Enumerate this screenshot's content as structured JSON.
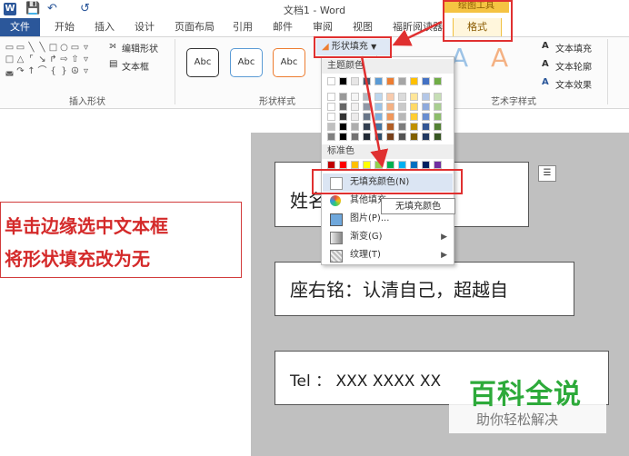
{
  "window": {
    "title": "文档1 - Word"
  },
  "quick_access": {
    "save_icon": "save-icon",
    "undo_icon": "undo-icon",
    "redo_icon": "redo-icon"
  },
  "context_tab": {
    "group": "绘图工具",
    "tab": "格式"
  },
  "tabs": [
    "文件",
    "开始",
    "插入",
    "设计",
    "页面布局",
    "引用",
    "邮件",
    "审阅",
    "视图",
    "福昕阅读器"
  ],
  "ribbon": {
    "insert_shapes": {
      "edit_shape": "编辑形状",
      "text_box": "文本框",
      "label": "插入形状"
    },
    "shape_styles": {
      "samples": [
        "Abc",
        "Abc",
        "Abc"
      ],
      "fill": "形状填充",
      "label": "形状样式"
    },
    "wordart": {
      "text_fill": "文本填充",
      "text_outline": "文本轮廓",
      "text_effects": "文本效果",
      "label": "艺术字样式",
      "sample": "A"
    }
  },
  "dropdown": {
    "theme_colors_label": "主题颜色",
    "standard_colors_label": "标准色",
    "theme_top": [
      "#ffffff",
      "#000000",
      "#e7e6e6",
      "#44546a",
      "#5b9bd5",
      "#ed7d31",
      "#a5a5a5",
      "#ffc000",
      "#4472c4",
      "#70ad47"
    ],
    "standard_colors": [
      "#c00000",
      "#ff0000",
      "#ffc000",
      "#ffff00",
      "#92d050",
      "#00b050",
      "#00b0f0",
      "#0070c0",
      "#002060",
      "#7030a0"
    ],
    "items": [
      {
        "label": "无填充颜色(N)",
        "icon": "no-fill-icon"
      },
      {
        "label": "其他填充",
        "icon": "palette-icon"
      },
      {
        "label": "图片(P)...",
        "icon": "picture-icon"
      },
      {
        "label": "渐变(G)",
        "icon": "gradient-icon"
      },
      {
        "label": "纹理(T)",
        "icon": "texture-icon"
      }
    ]
  },
  "tooltip": "无填充颜色",
  "document": {
    "box1_text": "姓名",
    "box2_text": "座右铭：认清自己，超越自",
    "box3_text": "Tel ： XXX XXXX XX"
  },
  "annotation": {
    "line1": "单击边缘选中文本框",
    "line2": "将形状填充改为无"
  },
  "watermark": {
    "title": "百科全说",
    "subtitle": "助你轻松解决"
  },
  "colors": {
    "accent": "#2b579a",
    "annotation_red": "#d42a2a",
    "context_tab": "#f5c342"
  }
}
